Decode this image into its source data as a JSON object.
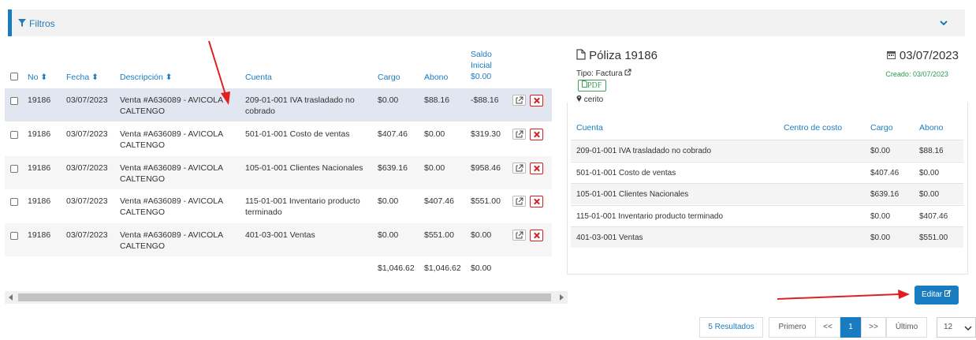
{
  "filters": {
    "label": "Filtros"
  },
  "table": {
    "headers": {
      "no": "No",
      "fecha": "Fecha",
      "descripcion": "Descripción",
      "cuenta": "Cuenta",
      "cargo": "Cargo",
      "abono": "Abono",
      "saldo_l1": "Saldo",
      "saldo_l2": "Inicial",
      "saldo_l3": "$0.00"
    },
    "rows": [
      {
        "no": "19186",
        "fecha": "03/07/2023",
        "desc1": "Venta #A636089 - AVICOLA",
        "desc2": "CALTENGO",
        "cuenta1": "209-01-001 IVA trasladado no",
        "cuenta2": "cobrado",
        "cargo": "$0.00",
        "abono": "$88.16",
        "saldo": "-$88.16"
      },
      {
        "no": "19186",
        "fecha": "03/07/2023",
        "desc1": "Venta #A636089 - AVICOLA",
        "desc2": "CALTENGO",
        "cuenta1": "501-01-001 Costo de ventas",
        "cuenta2": "",
        "cargo": "$407.46",
        "abono": "$0.00",
        "saldo": "$319.30"
      },
      {
        "no": "19186",
        "fecha": "03/07/2023",
        "desc1": "Venta #A636089 - AVICOLA",
        "desc2": "CALTENGO",
        "cuenta1": "105-01-001 Clientes Nacionales",
        "cuenta2": "",
        "cargo": "$639.16",
        "abono": "$0.00",
        "saldo": "$958.46"
      },
      {
        "no": "19186",
        "fecha": "03/07/2023",
        "desc1": "Venta #A636089 - AVICOLA",
        "desc2": "CALTENGO",
        "cuenta1": "115-01-001 Inventario producto",
        "cuenta2": "terminado",
        "cargo": "$0.00",
        "abono": "$407.46",
        "saldo": "$551.00"
      },
      {
        "no": "19186",
        "fecha": "03/07/2023",
        "desc1": "Venta #A636089 - AVICOLA",
        "desc2": "CALTENGO",
        "cuenta1": "401-03-001 Ventas",
        "cuenta2": "",
        "cargo": "$0.00",
        "abono": "$551.00",
        "saldo": "$0.00"
      }
    ],
    "totals": {
      "cargo": "$1,046.62",
      "abono": "$1,046.62",
      "saldo": "$0.00"
    }
  },
  "detail": {
    "title": "Póliza 19186",
    "date": "03/07/2023",
    "tipo": "Tipo: Factura",
    "creado": "Creado: 03/07/2023",
    "pdf": "PDF",
    "location": "cerito",
    "headers": {
      "cuenta": "Cuenta",
      "centro": "Centro de costo",
      "cargo": "Cargo",
      "abono": "Abono"
    },
    "rows": [
      {
        "cuenta": "209-01-001 IVA trasladado no cobrado",
        "cargo": "$0.00",
        "abono": "$88.16"
      },
      {
        "cuenta": "501-01-001 Costo de ventas",
        "cargo": "$407.46",
        "abono": "$0.00"
      },
      {
        "cuenta": "105-01-001 Clientes Nacionales",
        "cargo": "$639.16",
        "abono": "$0.00"
      },
      {
        "cuenta": "115-01-001 Inventario producto terminado",
        "cargo": "$0.00",
        "abono": "$407.46"
      },
      {
        "cuenta": "401-03-001 Ventas",
        "cargo": "$0.00",
        "abono": "$551.00"
      }
    ],
    "edit_label": "Editar"
  },
  "pagination": {
    "results": "5 Resultados",
    "first": "Primero",
    "prev": "<<",
    "page": "1",
    "next": ">>",
    "last": "Último",
    "page_size": "12"
  },
  "colors": {
    "accent": "#1a7cc0",
    "danger": "#d42020",
    "success": "#3aa05a",
    "annotation": "#e02020"
  }
}
